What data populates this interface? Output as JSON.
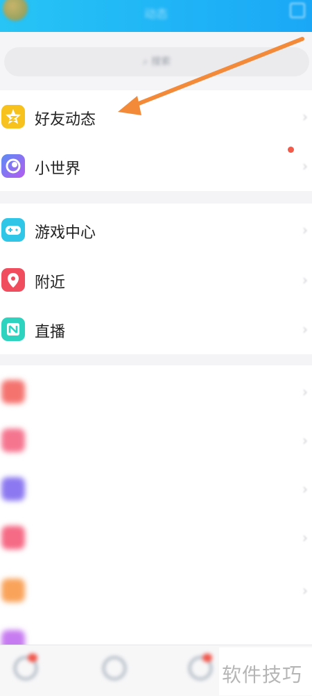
{
  "header": {
    "title": "动态"
  },
  "search": {
    "placeholder": "搜索"
  },
  "section1": [
    {
      "label": "好友动态",
      "icon": "star-icon",
      "color": "#f7c21d"
    },
    {
      "label": "小世界",
      "icon": "planet-icon",
      "color": "#7a6df5",
      "side": ""
    }
  ],
  "section2": [
    {
      "label": "游戏中心",
      "icon": "gamepad-icon",
      "color": "#2fc6e8"
    },
    {
      "label": "附近",
      "icon": "location-pin-icon",
      "color": "#f04e5e"
    },
    {
      "label": "直播",
      "icon": "live-icon",
      "color": "#2ed3c0"
    }
  ],
  "section3": [
    {
      "label": "",
      "color": "#f4736f"
    },
    {
      "label": "",
      "color": "#f5758f"
    },
    {
      "label": "",
      "color": "#8c78f0"
    },
    {
      "label": "",
      "color": "#f56a85"
    },
    {
      "label": "",
      "color": "#f9a35a"
    },
    {
      "label": "",
      "color": "#c77bf0"
    }
  ],
  "watermark": "软件技巧"
}
